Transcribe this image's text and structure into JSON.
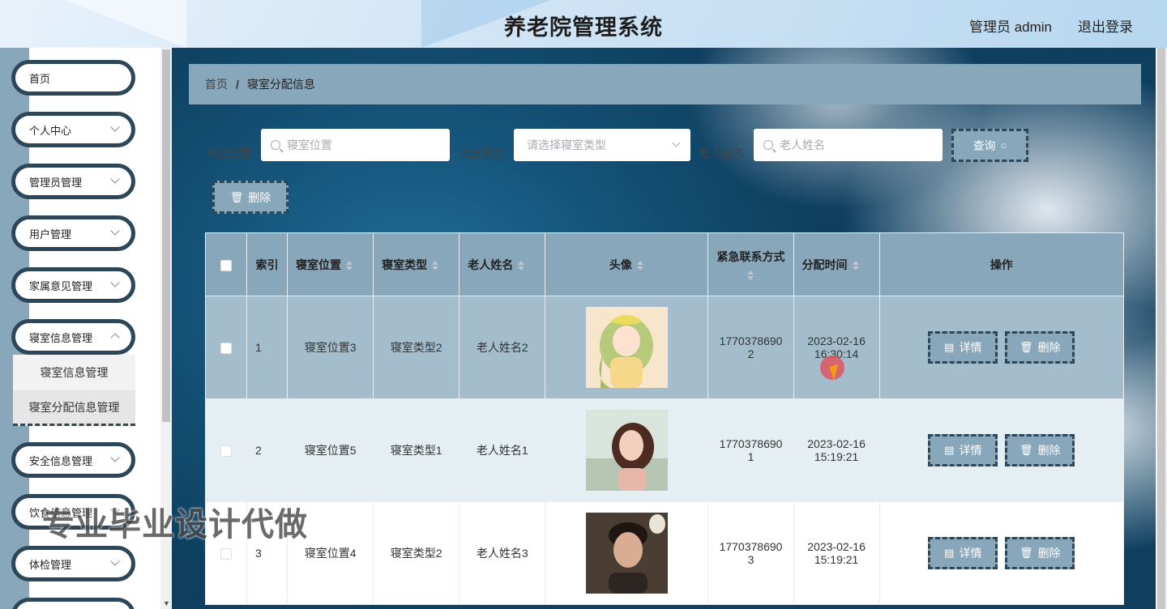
{
  "header": {
    "title": "养老院管理系统",
    "admin": "管理员 admin",
    "logout": "退出登录"
  },
  "sidebar": {
    "items": [
      {
        "label": "首页"
      },
      {
        "label": "个人中心"
      },
      {
        "label": "管理员管理"
      },
      {
        "label": "用户管理"
      },
      {
        "label": "家属意见管理"
      },
      {
        "label": "寝室信息管理"
      },
      {
        "label": "安全信息管理"
      },
      {
        "label": "饮食信息管理"
      },
      {
        "label": "体检管理"
      }
    ],
    "submenu": [
      {
        "label": "寝室信息管理"
      },
      {
        "label": "寝室分配信息管理"
      }
    ]
  },
  "breadcrumb": {
    "home": "首页",
    "separator": "/",
    "current": "寝室分配信息"
  },
  "search": {
    "label1": "寝室位置",
    "placeholder1": "寝室位置",
    "label2": "寝室类型",
    "placeholder2": "请选择寝室类型",
    "label3": "老人姓名",
    "placeholder3": "老人姓名",
    "query": "查询"
  },
  "actions": {
    "delete": "删除"
  },
  "table": {
    "headers": {
      "index": "索引",
      "location": "寝室位置",
      "type": "寝室类型",
      "name": "老人姓名",
      "avatar": "头像",
      "contact": "紧急联系方式",
      "time": "分配时间",
      "ops": "操作"
    },
    "rows": [
      {
        "index": "1",
        "location": "寝室位置3",
        "type": "寝室类型2",
        "name": "老人姓名2",
        "contact_a": "1770378690",
        "contact_b": "2",
        "date": "2023-02-16",
        "time": "16:30:14"
      },
      {
        "index": "2",
        "location": "寝室位置5",
        "type": "寝室类型1",
        "name": "老人姓名1",
        "contact_a": "1770378690",
        "contact_b": "1",
        "date": "2023-02-16",
        "time": "15:19:21"
      },
      {
        "index": "3",
        "location": "寝室位置4",
        "type": "寝室类型2",
        "name": "老人姓名3",
        "contact_a": "1770378690",
        "contact_b": "3",
        "date": "2023-02-16",
        "time": "15:19:21"
      }
    ],
    "detail": "详情",
    "delete": "删除"
  },
  "watermark": "专业毕业设计代做",
  "colors": {
    "primary": "#88a7ba",
    "dark": "#2d4658"
  }
}
